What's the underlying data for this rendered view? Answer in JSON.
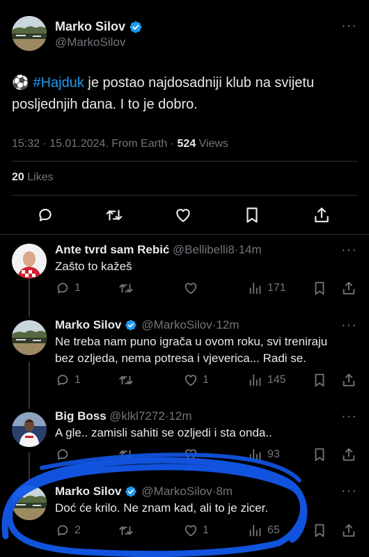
{
  "main_tweet": {
    "author_name": "Marko Silov",
    "handle": "@MarkoSilov",
    "emoji": "⚽",
    "hashtag": "#Hajduk",
    "text_line1": " je postao najdosadniji klub na svijetu",
    "text_line2": "posljednjih dana. I to je dobro.",
    "time": "15:32",
    "date": "15.01.2024",
    "source": "From Earth",
    "views_count": "524",
    "views_label": " Views",
    "likes_count": "20",
    "likes_label": " Likes"
  },
  "replies": [
    {
      "name": "Ante tvrd sam Rebić",
      "handle": "@Bellibelli8",
      "time": "14m",
      "text": "Zašto to kažeš",
      "comments": "1",
      "likes": "",
      "views": "171",
      "verified": false
    },
    {
      "name": "Marko Silov",
      "handle": "@MarkoSilov",
      "time": "12m",
      "text_line1": "Ne treba nam puno igrača u ovom roku, svi treniraju",
      "text_line2": "bez ozljeda, nema potresa i vjeverica... Radi se.",
      "comments": "1",
      "likes": "1",
      "views": "145",
      "verified": true
    },
    {
      "name": "Big Boss",
      "handle": "@klkl7272",
      "time": "12m",
      "text": "A gle.. zamisli sahiti se ozljedi i sta onda..",
      "comments": "",
      "likes": "",
      "views": "93",
      "verified": false
    },
    {
      "name": "Marko Silov",
      "handle": "@MarkoSilov",
      "time": "8m",
      "text": "Doć će krilo. Ne znam kad, ali to je zicer.",
      "comments": "2",
      "likes": "1",
      "views": "65",
      "verified": true
    }
  ],
  "separator": "·",
  "colors": {
    "background": "#000000",
    "text": "#e7e9ea",
    "muted": "#71767b",
    "hashtag": "#1d9bf0",
    "verified": "#1d9bf0",
    "annotation": "#1257e8"
  }
}
